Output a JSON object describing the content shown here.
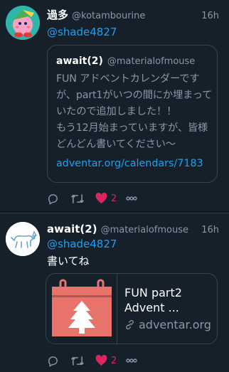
{
  "tweet1": {
    "display_name": "過多",
    "handle": "@kotambourine",
    "time": "16h",
    "reply_to": "@shade4827",
    "quote": {
      "display_name": "await(2)",
      "handle": "@materialofmouse",
      "text": "FUN アドベントカレンダーですが、part1がいつの間にか埋まっていたので追加しました！！\nもう12月始まっていますが、皆様どんどん書いてください〜",
      "link": "adventar.org/calendars/7183"
    },
    "actions": {
      "like_count": "2"
    }
  },
  "tweet2": {
    "display_name": "await(2)",
    "handle": "@materialofmouse",
    "time": "16h",
    "reply_to": "@shade4827",
    "text": "書いてね",
    "card": {
      "title": "FUN part2\nAdvent ...",
      "domain": "adventar.org"
    },
    "actions": {
      "like_count": "2"
    }
  },
  "colors": {
    "background": "#15202b",
    "link": "#1da1f2",
    "secondary_text": "#8899a6",
    "like": "#e0245e",
    "border": "#38444d",
    "card_calendar": "#e8736a"
  },
  "icons": [
    "reply-icon",
    "retweet-icon",
    "heart-icon",
    "more-icon",
    "link-icon",
    "calendar-tree-icon"
  ]
}
